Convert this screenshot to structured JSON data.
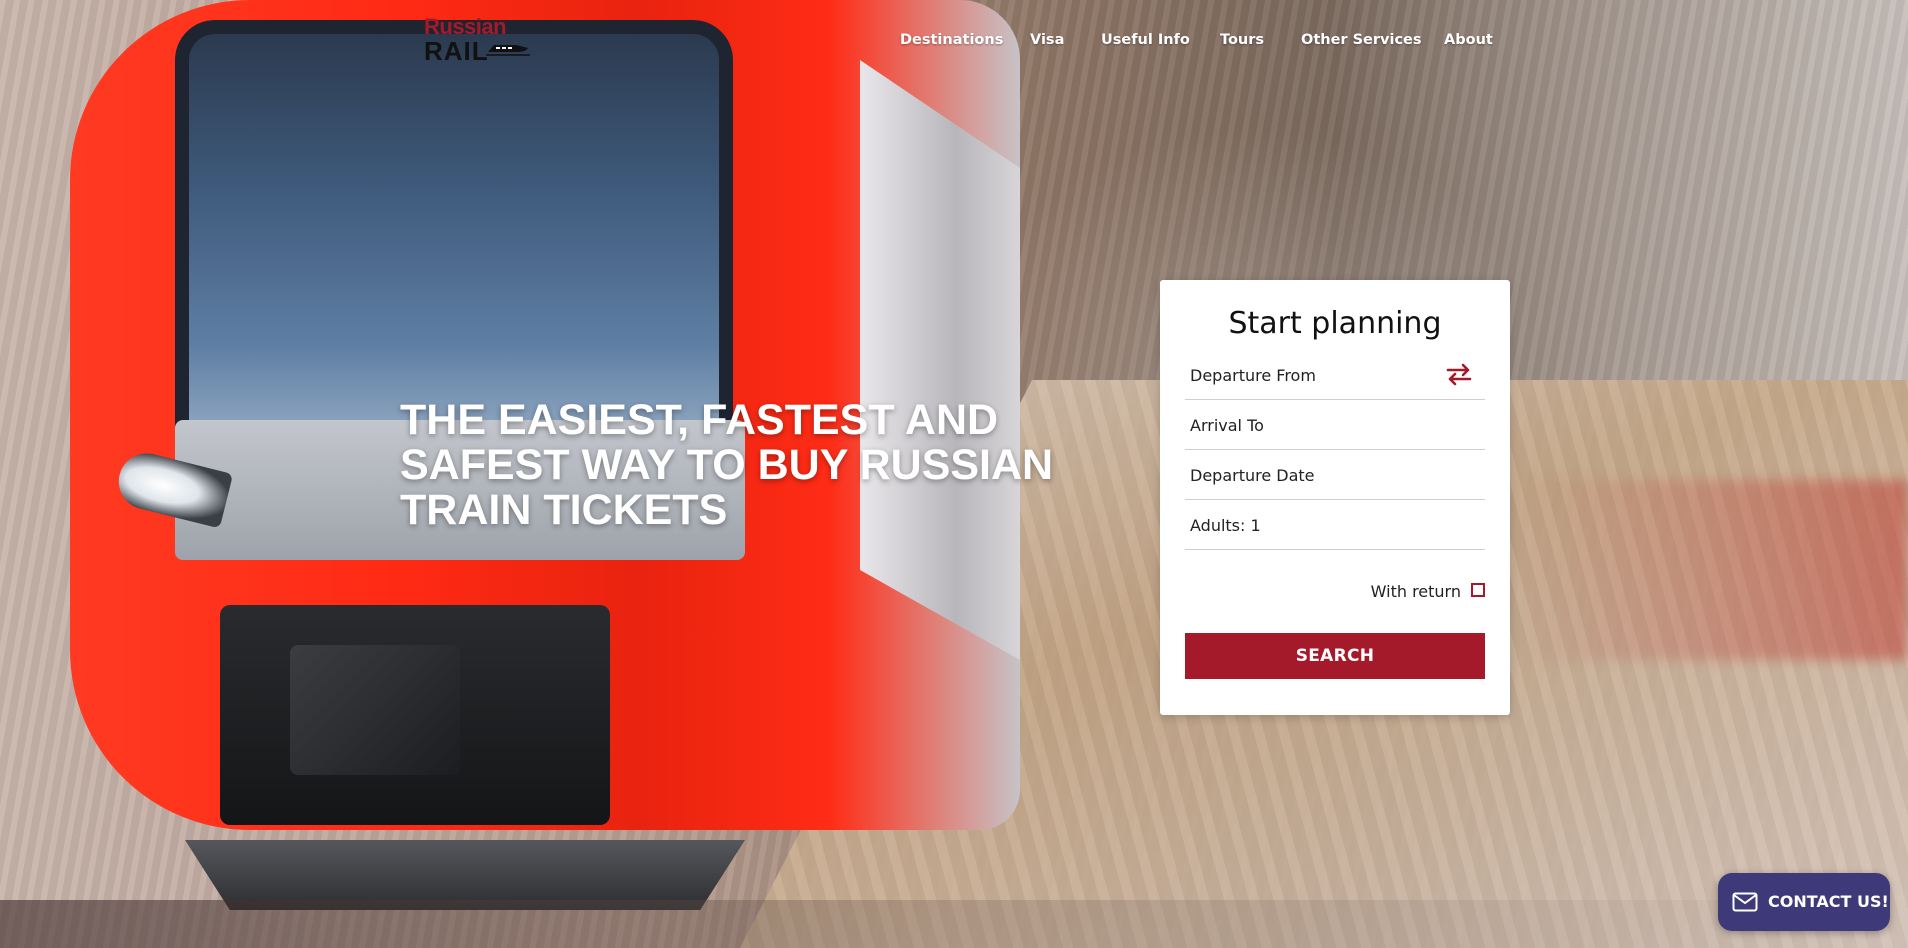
{
  "header": {
    "logo": {
      "top": "Russian",
      "bottom": "RAIL",
      "icon": "train-icon",
      "color": "#a51a2b"
    },
    "nav": [
      {
        "label": "Destinations"
      },
      {
        "label": "Visa"
      },
      {
        "label": "Useful Info"
      },
      {
        "label": "Tours"
      },
      {
        "label": "Other Services"
      },
      {
        "label": "About"
      }
    ]
  },
  "hero": {
    "headline": "THE EASIEST, FASTEST AND SAFEST WAY TO BUY RUSSIAN TRAIN TICKETS"
  },
  "form": {
    "title": "Start planning",
    "departure_from": "Departure From",
    "swap_icon": "swap-arrows-icon",
    "arrival_to": "Arrival To",
    "departure_date": "Departure Date",
    "adults": "Adults: 1",
    "with_return": "With return",
    "with_return_checked": false,
    "search_label": "SEARCH",
    "accent_color": "#a51a2b"
  },
  "contact": {
    "label": "CONTACT US!",
    "icon": "envelope-icon",
    "color": "#3e3a7a"
  }
}
